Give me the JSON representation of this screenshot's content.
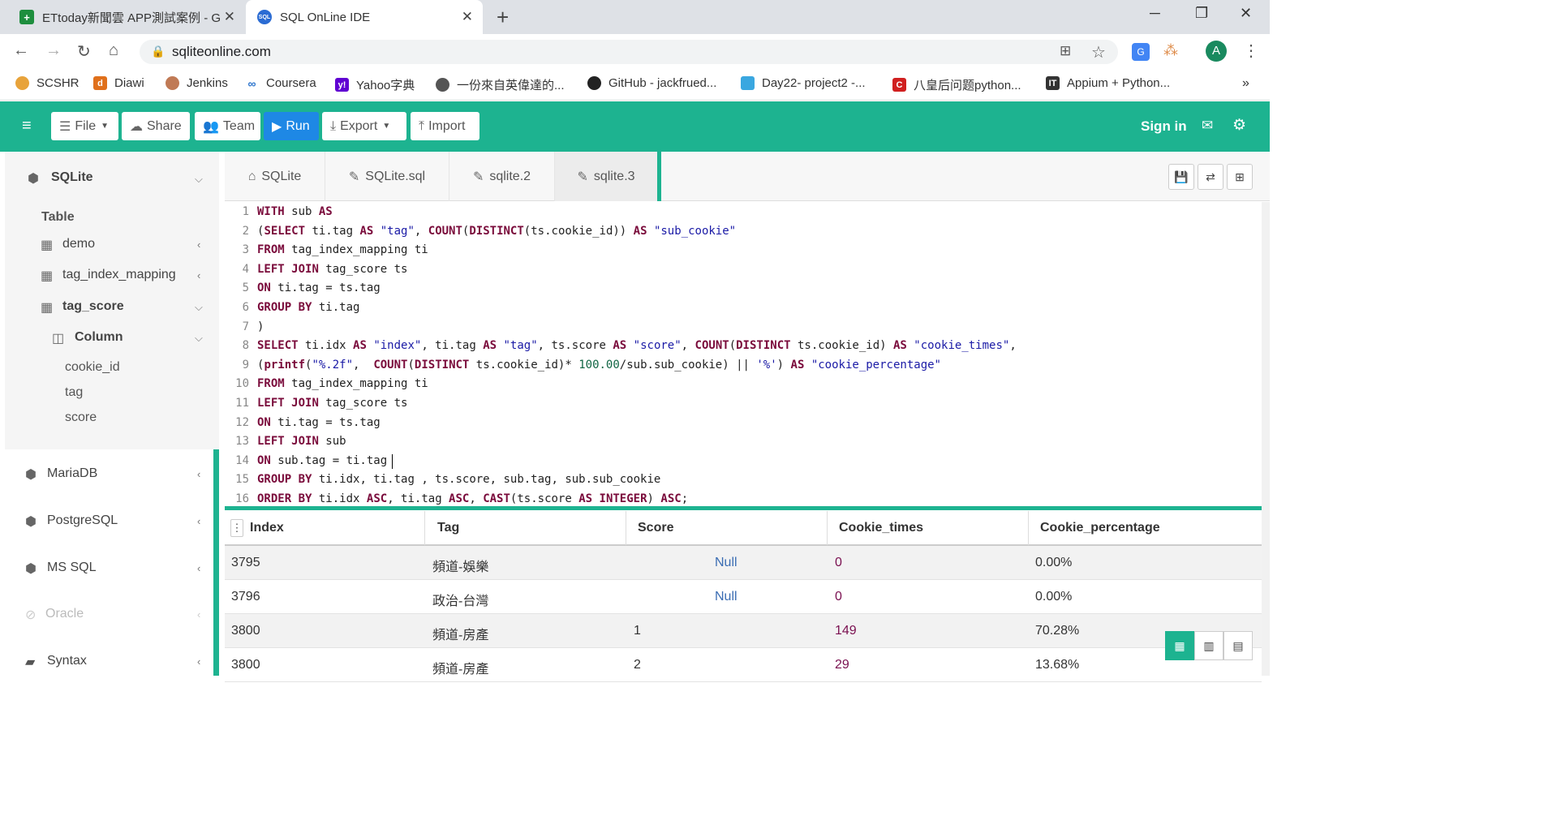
{
  "browser": {
    "tabs": [
      {
        "title": "ETtoday新聞雲 APP測試案例 - G",
        "icon": "sheets-icon"
      },
      {
        "title": "SQL OnLine IDE",
        "icon": "sql-cloud-icon"
      }
    ],
    "url": "sqliteonline.com",
    "profile_initial": "A",
    "bookmarks": [
      {
        "label": "SCSHR",
        "icon": "globe-icon",
        "color": "#e8a33b"
      },
      {
        "label": "Diawi",
        "icon": "diawi-icon",
        "color": "#e0701b"
      },
      {
        "label": "Jenkins",
        "icon": "jenkins-icon",
        "color": "#c07a55"
      },
      {
        "label": "Coursera",
        "icon": "coursera-icon",
        "color": "#2a73cc"
      },
      {
        "label": "Yahoo字典",
        "icon": "yahoo-icon",
        "color": "#6001d2"
      },
      {
        "label": "一份來自英偉達的...",
        "icon": "globe-icon",
        "color": "#555555"
      },
      {
        "label": "GitHub - jackfrued...",
        "icon": "github-icon",
        "color": "#222222"
      },
      {
        "label": "Day22- project2 -...",
        "icon": "day22-icon",
        "color": "#3aa7e0"
      },
      {
        "label": "八皇后问题python...",
        "icon": "c-icon",
        "color": "#d02020"
      },
      {
        "label": "Appium + Python...",
        "icon": "it-icon",
        "color": "#333333"
      }
    ]
  },
  "toolbar": {
    "file": "File",
    "share": "Share",
    "team": "Team",
    "run": "Run",
    "export": "Export",
    "import": "Import",
    "signin": "Sign in"
  },
  "sidebar": {
    "db_main": "SQLite",
    "table_header": "Table",
    "tables": [
      "demo",
      "tag_index_mapping",
      "tag_score"
    ],
    "column_header": "Column",
    "columns": [
      "cookie_id",
      "tag",
      "score"
    ],
    "other_dbs": [
      "MariaDB",
      "PostgreSQL",
      "MS SQL",
      "Oracle",
      "Syntax"
    ]
  },
  "editor_tabs": [
    "SQLite",
    "SQLite.sql",
    "sqlite.2",
    "sqlite.3"
  ],
  "code_lines": [
    "WITH sub AS",
    "(SELECT ti.tag AS \"tag\", COUNT(DISTINCT(ts.cookie_id)) AS \"sub_cookie\"",
    "FROM tag_index_mapping ti",
    "LEFT JOIN tag_score ts",
    "ON ti.tag = ts.tag",
    "GROUP BY ti.tag",
    ")",
    "SELECT ti.idx AS \"index\", ti.tag AS \"tag\", ts.score AS \"score\", COUNT(DISTINCT ts.cookie_id) AS \"cookie_times\",",
    "(printf(\"%.2f\",  COUNT(DISTINCT ts.cookie_id)* 100.00/sub.sub_cookie) || '%') AS \"cookie_percentage\"",
    "FROM tag_index_mapping ti",
    "LEFT JOIN tag_score ts",
    "ON ti.tag = ts.tag",
    "LEFT JOIN sub",
    "ON sub.tag = ti.tag",
    "GROUP BY ti.idx, ti.tag , ts.score, sub.tag, sub.sub_cookie",
    "ORDER BY ti.idx ASC, ti.tag ASC, CAST(ts.score AS INTEGER) ASC;"
  ],
  "results": {
    "headers": [
      "Index",
      "Tag",
      "Score",
      "Cookie_times",
      "Cookie_percentage"
    ],
    "rows": [
      [
        "3795",
        "頻道-娛樂",
        "Null",
        "0",
        "0.00%"
      ],
      [
        "3796",
        "政治-台灣",
        "Null",
        "0",
        "0.00%"
      ],
      [
        "3800",
        "頻道-房產",
        "1",
        "149",
        "70.28%"
      ],
      [
        "3800",
        "頻道-房產",
        "2",
        "29",
        "13.68%"
      ]
    ]
  },
  "colors": {
    "accent": "#1db390",
    "run": "#1e88e5"
  }
}
